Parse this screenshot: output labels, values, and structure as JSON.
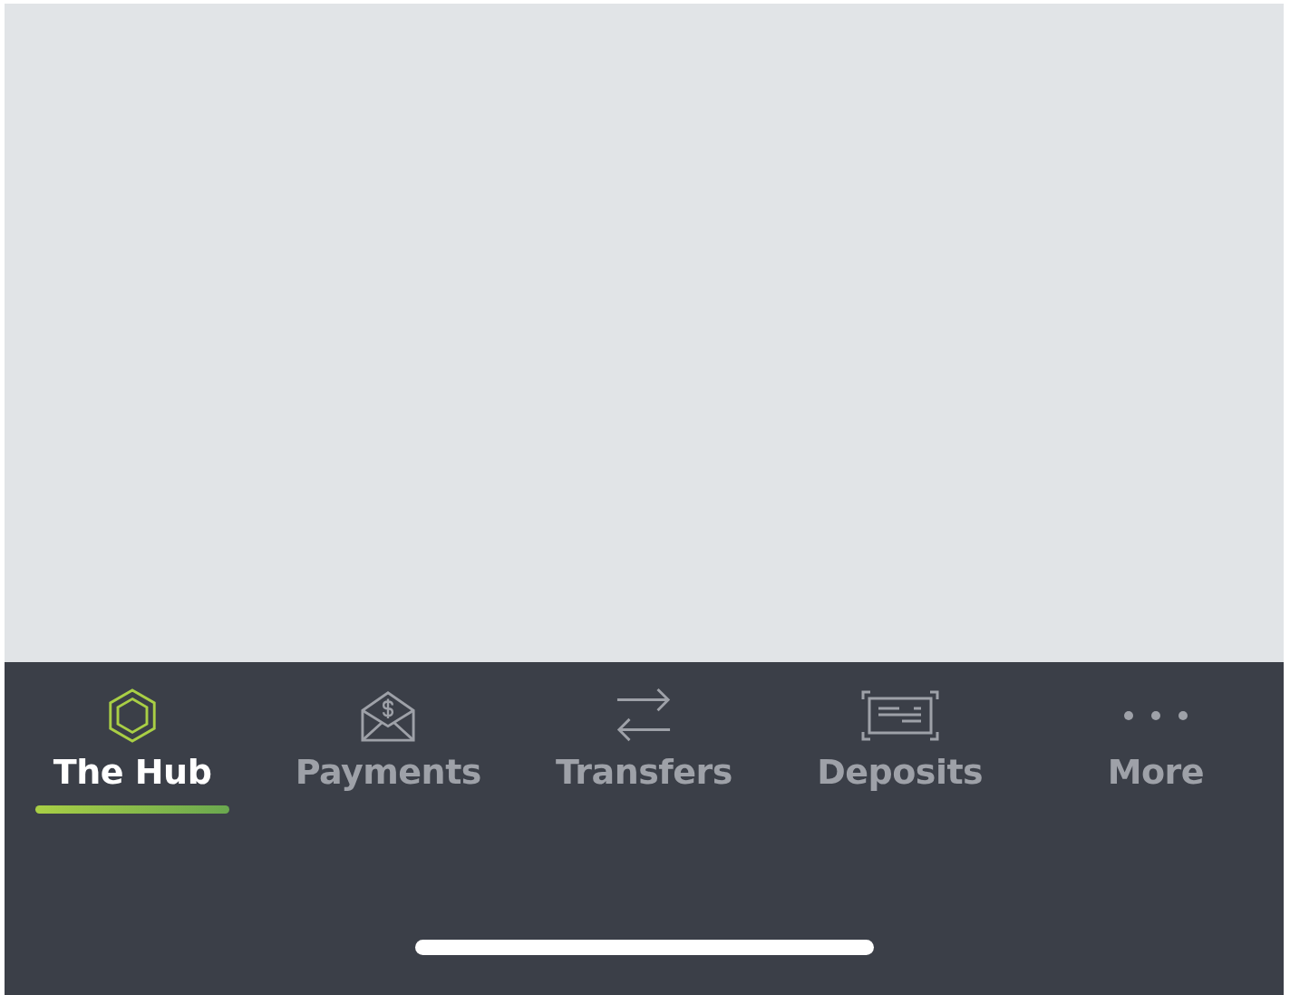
{
  "tabs": [
    {
      "label": "The Hub",
      "kind": "hub",
      "selected": true
    },
    {
      "label": "Payments",
      "kind": "payments",
      "selected": false
    },
    {
      "label": "Transfers",
      "kind": "transfers",
      "selected": false
    },
    {
      "label": "Deposits",
      "kind": "deposits",
      "selected": false
    },
    {
      "label": "More",
      "kind": "more",
      "selected": false
    }
  ]
}
